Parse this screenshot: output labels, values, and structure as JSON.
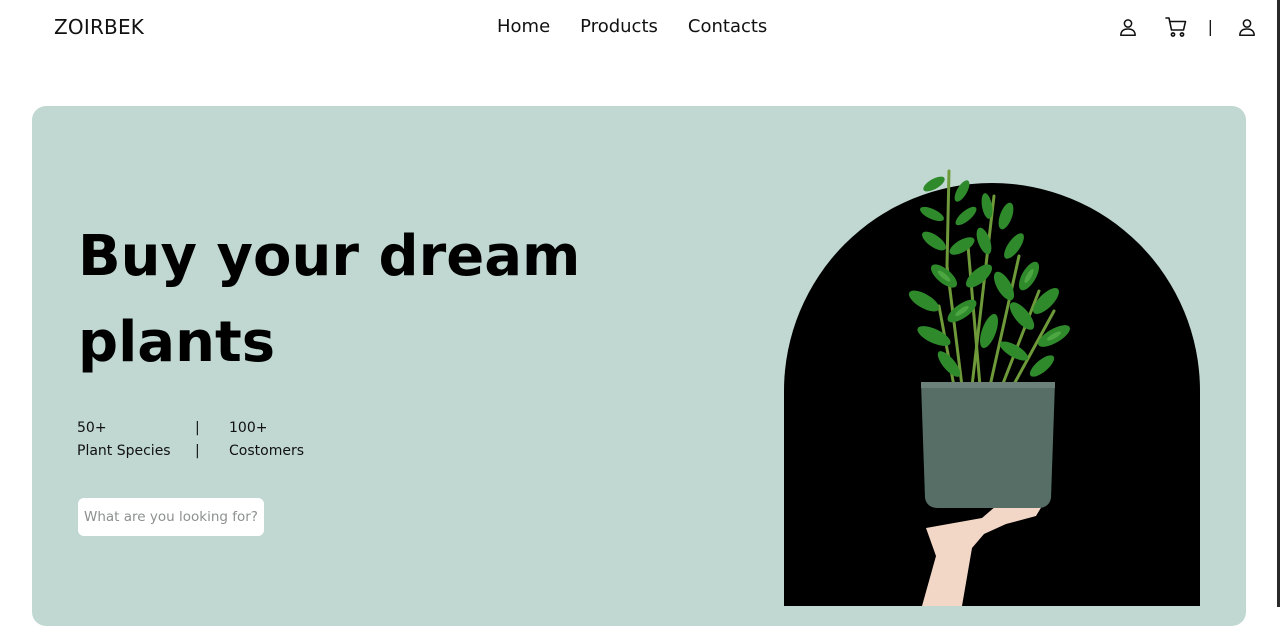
{
  "header": {
    "logo": "ZOIRBEK",
    "nav": [
      {
        "label": "Home"
      },
      {
        "label": "Products"
      },
      {
        "label": "Contacts"
      }
    ],
    "actions": {
      "icons": [
        "user-icon",
        "cart-icon",
        "user-icon"
      ],
      "separator": "|"
    }
  },
  "hero": {
    "title": "Buy your dream plants",
    "stats": {
      "species_value": "50+",
      "species_label": "Plant Species",
      "customers_value": "100+",
      "customers_label": "Costomers",
      "separator": "|"
    },
    "search": {
      "placeholder": "What are you looking for?",
      "value": ""
    },
    "image": {
      "description_icon": "plant-pot-icon"
    }
  },
  "colors": {
    "hero_background": "#c0d8d1",
    "arch_background": "#000000",
    "pot": "#566e66",
    "leaf": "#2f8a2c",
    "text": "#111111"
  }
}
